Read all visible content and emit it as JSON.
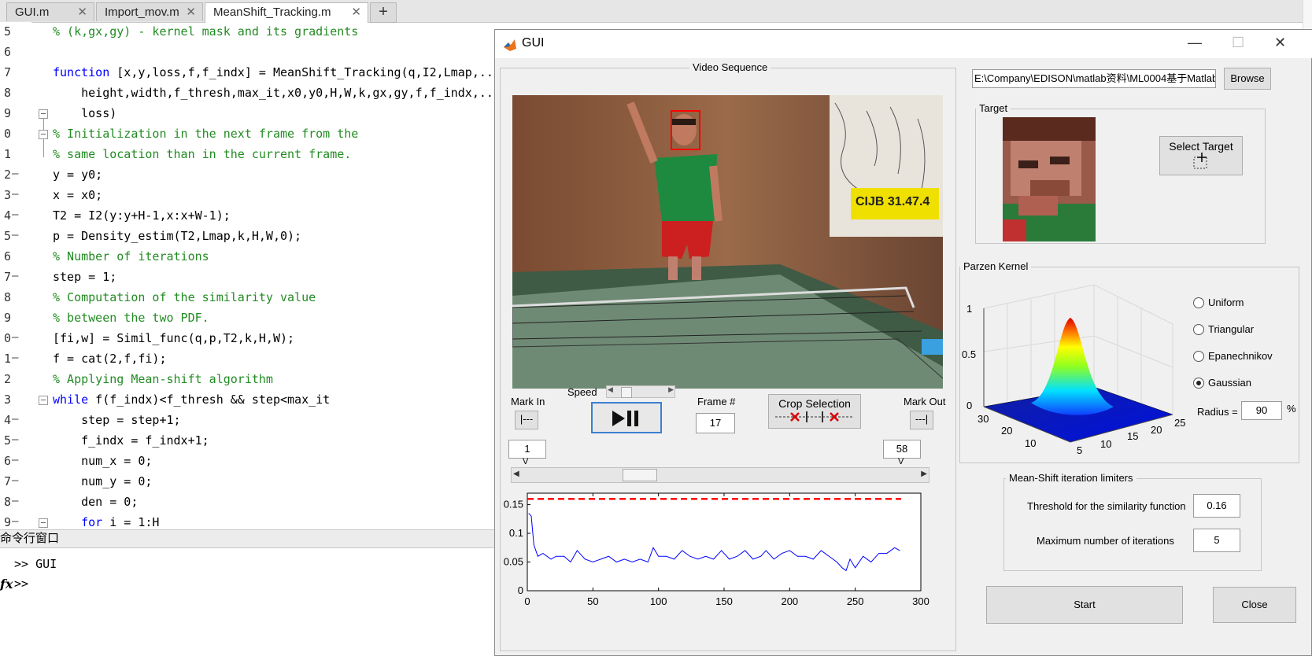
{
  "editor": {
    "tabs": [
      {
        "label": "GUI.m",
        "active": false
      },
      {
        "label": "Import_mov.m",
        "active": false
      },
      {
        "label": "MeanShift_Tracking.m",
        "active": true
      }
    ],
    "line_numbers": [
      "5",
      "6",
      "7",
      "8",
      "9",
      "0",
      "1",
      "2",
      "3",
      "4",
      "5",
      "6",
      "7",
      "8",
      "9",
      "0",
      "1",
      "2",
      "3",
      "4",
      "5",
      "6",
      "7",
      "8",
      "9"
    ],
    "lines": [
      "% (k,gx,gy) - kernel mask and its gradients",
      "",
      "function [x,y,loss,f,f_indx] = MeanShift_Tracking(q,I2,Lmap,...",
      "    height,width,f_thresh,max_it,x0,y0,H,W,k,gx,gy,f,f_indx,...",
      "    loss)",
      "% Initialization in the next frame from the",
      "% same location than in the current frame.",
      "y = y0;",
      "x = x0;",
      "T2 = I2(y:y+H-1,x:x+W-1);",
      "p = Density_estim(T2,Lmap,k,H,W,0);",
      "% Number of iterations",
      "step = 1;",
      "% Computation of the similarity value",
      "% between the two PDF.",
      "[fi,w] = Simil_func(q,p,T2,k,H,W);",
      "f = cat(2,f,fi);",
      "% Applying Mean-shift algorithm",
      "while f(f_indx)<f_thresh && step<max_it",
      "    step = step+1;",
      "    f_indx = f_indx+1;",
      "    num_x = 0;",
      "    num_y = 0;",
      "    den = 0;",
      "    for i = 1:H"
    ],
    "command_window_title": "命令行窗口",
    "command_lines": [
      ">> GUI",
      ">>"
    ],
    "fx_symbol": "fx"
  },
  "gui": {
    "title": "GUI",
    "window_controls": {
      "minimize": "—",
      "maximize": "☐",
      "close": "✕"
    },
    "video_panel": {
      "title": "Video Sequence",
      "mark_in_label": "Mark In",
      "speed_label": "Speed",
      "frame_label": "Frame #",
      "frame_value": "17",
      "crop_label": "Crop Selection",
      "mark_out_label": "Mark Out",
      "mark_in_value": "1",
      "mark_out_value": "58",
      "mark_in_arrow": "V",
      "mark_out_arrow": "V",
      "speed_fraction": 0.1,
      "frame_slider_fraction": 0.28
    },
    "similarity_plot": {
      "yticks": [
        "0.15",
        "0.1",
        "0.05",
        "0"
      ],
      "xticks": [
        "0",
        "50",
        "100",
        "150",
        "200",
        "250",
        "300"
      ]
    },
    "path_value": "E:\\Company\\EDISON\\matlab资料\\ML0004基于Matlab实现",
    "browse_label": "Browse",
    "target_panel": {
      "title": "Target",
      "select_label": "Select Target"
    },
    "parzen_panel": {
      "title": "Parzen Kernel",
      "zticks": [
        "1",
        "0.5",
        "0"
      ],
      "x_left_ticks": [
        "30",
        "20",
        "10"
      ],
      "x_right_ticks": [
        "5",
        "10",
        "15",
        "20",
        "25"
      ],
      "options": [
        {
          "label": "Uniform",
          "selected": false
        },
        {
          "label": "Triangular",
          "selected": false
        },
        {
          "label": "Epanechnikov",
          "selected": false
        },
        {
          "label": "Gaussian",
          "selected": true
        }
      ],
      "radius_label": "Radius =",
      "radius_value": "90",
      "radius_unit": "%"
    },
    "limiters_panel": {
      "title": "Mean-Shift iteration limiters",
      "threshold_label": "Threshold for the similarity function",
      "threshold_value": "0.16",
      "max_iter_label": "Maximum number of iterations",
      "max_iter_value": "5"
    },
    "start_label": "Start",
    "close_label": "Close"
  },
  "chart_data": {
    "type": "line",
    "xlim": [
      0,
      300
    ],
    "ylim": [
      0,
      0.17
    ],
    "series": [
      {
        "x": [
          0,
          285
        ],
        "y": [
          0.16,
          0.16
        ],
        "color": "#ff0000",
        "style": "dashed"
      },
      {
        "x": [
          1,
          3,
          5,
          8,
          12,
          18,
          22,
          28,
          33,
          38,
          44,
          50,
          56,
          62,
          68,
          74,
          80,
          86,
          92,
          96,
          100,
          106,
          112,
          118,
          124,
          130,
          136,
          142,
          148,
          154,
          160,
          166,
          172,
          178,
          182,
          188,
          194,
          200,
          206,
          212,
          218,
          224,
          230,
          236,
          240,
          243,
          246,
          250,
          256,
          262,
          268,
          274,
          280,
          284
        ],
        "y": [
          0.135,
          0.13,
          0.08,
          0.06,
          0.065,
          0.055,
          0.06,
          0.06,
          0.05,
          0.07,
          0.055,
          0.05,
          0.055,
          0.06,
          0.05,
          0.055,
          0.05,
          0.055,
          0.05,
          0.075,
          0.06,
          0.06,
          0.055,
          0.07,
          0.06,
          0.055,
          0.06,
          0.055,
          0.07,
          0.055,
          0.06,
          0.07,
          0.055,
          0.06,
          0.07,
          0.055,
          0.065,
          0.07,
          0.06,
          0.06,
          0.055,
          0.07,
          0.06,
          0.05,
          0.04,
          0.035,
          0.055,
          0.04,
          0.06,
          0.05,
          0.065,
          0.065,
          0.075,
          0.07
        ],
        "color": "#0000ff",
        "style": "solid"
      }
    ]
  }
}
